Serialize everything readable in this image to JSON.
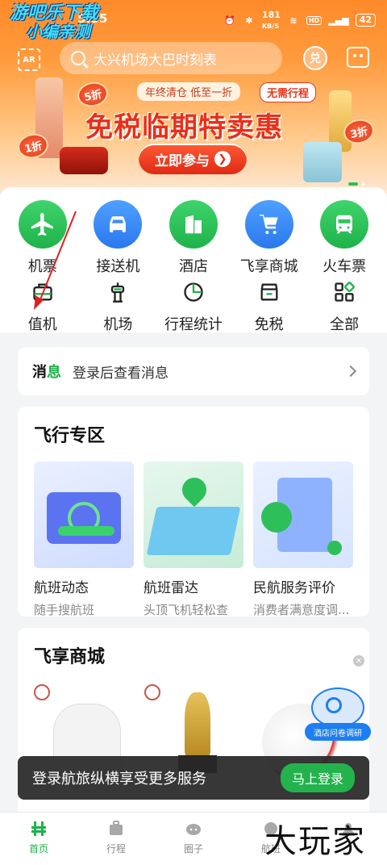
{
  "status": {
    "time": "5:55",
    "speed": "181",
    "speed_unit": "KB/S",
    "battery": "42"
  },
  "watermark": {
    "line1": "游吧乐下载",
    "line2": "小编亲测"
  },
  "header": {
    "ar_label": "AR",
    "search_placeholder": "大兴机场大巴时刻表",
    "redeem_label": "兑"
  },
  "banner": {
    "subtitle": "年终清仓 低至一折",
    "tag": "无需行程",
    "title": "免税临期特卖惠",
    "button": "立即参与",
    "badges": [
      "5折",
      "1折",
      "3折"
    ]
  },
  "quick_main": [
    {
      "label": "机票",
      "icon": "plane-icon"
    },
    {
      "label": "接送机",
      "icon": "car-icon"
    },
    {
      "label": "酒店",
      "icon": "hotel-icon"
    },
    {
      "label": "飞享商城",
      "icon": "cart-icon"
    },
    {
      "label": "火车票",
      "icon": "train-icon"
    }
  ],
  "quick_sub": [
    {
      "label": "值机",
      "icon": "checkin-icon"
    },
    {
      "label": "机场",
      "icon": "airport-icon"
    },
    {
      "label": "行程统计",
      "icon": "pie-chart-icon"
    },
    {
      "label": "免税",
      "icon": "shop-icon"
    },
    {
      "label": "全部",
      "icon": "grid-icon"
    }
  ],
  "notice": {
    "k1": "消",
    "k2": "息",
    "text": "登录后查看消息"
  },
  "flight_zone": {
    "title": "飞行专区",
    "items": [
      {
        "title": "航班动态",
        "desc": "随手搜航班"
      },
      {
        "title": "航班雷达",
        "desc": "头顶飞机轻松查"
      },
      {
        "title": "民航服务评价",
        "desc": "消费者满意度调..."
      }
    ]
  },
  "mall": {
    "title": "飞享商城",
    "survey_label": "酒店问卷调研"
  },
  "login_bar": {
    "text": "登录航旅纵横享受更多服务",
    "button": "马上登录"
  },
  "tabs": [
    {
      "label": "首页",
      "active": true
    },
    {
      "label": "行程",
      "active": false
    },
    {
      "label": "圈子",
      "active": false
    },
    {
      "label": "航班",
      "active": false
    },
    {
      "label": "",
      "active": false
    }
  ],
  "bottom_watermark": "大玩家",
  "colors": {
    "accent": "#1fb24a",
    "banner": "#ff8a2a",
    "promo_red": "#e8301a"
  }
}
